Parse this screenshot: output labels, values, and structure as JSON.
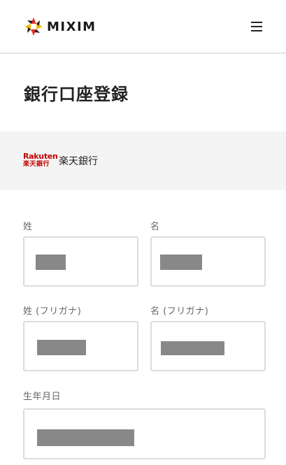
{
  "header": {
    "logo_text": "MIXIM",
    "menu_icon": "hamburger-menu-icon"
  },
  "page": {
    "title": "銀行口座登録"
  },
  "bank": {
    "logo_text_en": "Rakuten",
    "logo_text_ja": "楽天銀行",
    "name": "楽天銀行",
    "brand_color": "#bf0000"
  },
  "form": {
    "last_name": {
      "label": "姓",
      "value_redacted": true
    },
    "first_name": {
      "label": "名",
      "value_redacted": true
    },
    "last_name_kana": {
      "label": "姓 (フリガナ)",
      "value_redacted": true
    },
    "first_name_kana": {
      "label": "名 (フリガナ)",
      "value_redacted": true
    },
    "birth_date": {
      "label": "生年月日",
      "value_redacted": true
    }
  },
  "colors": {
    "border": "#dcdcdc",
    "band_background": "#f4f4f4",
    "redaction": "#888888"
  }
}
